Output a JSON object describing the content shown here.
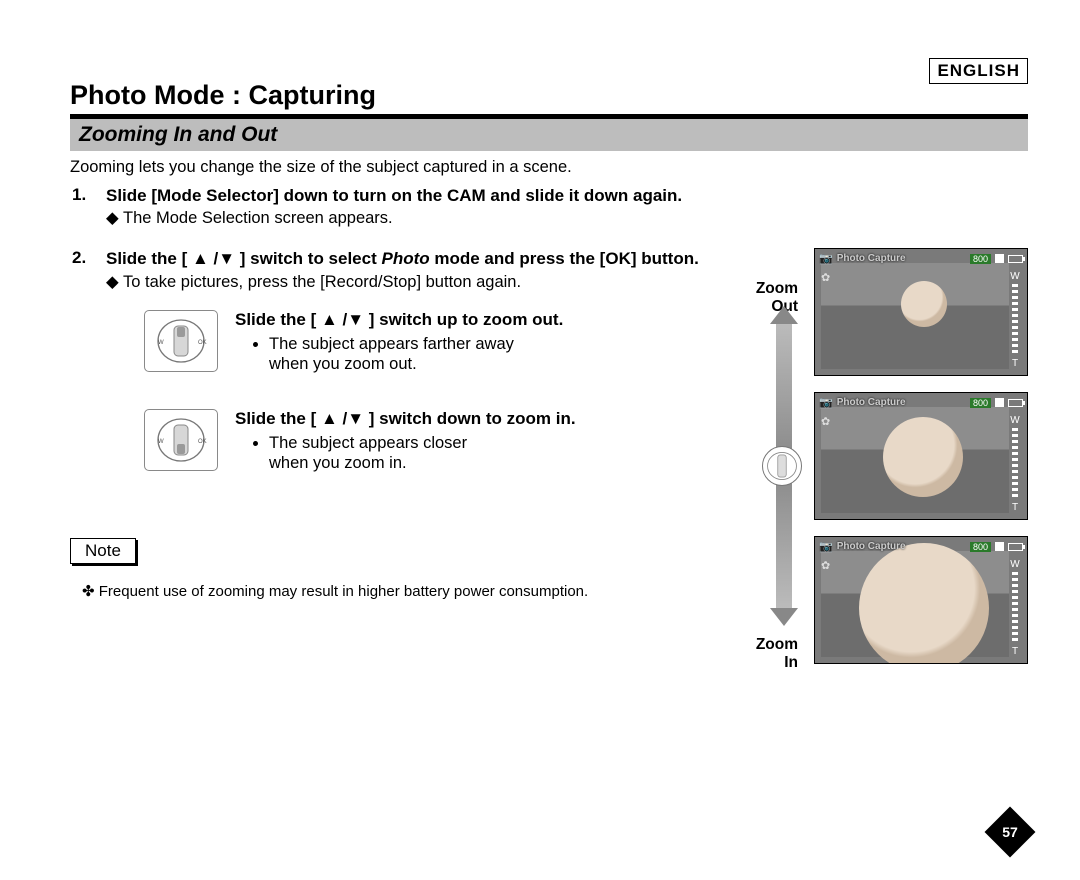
{
  "language": "ENGLISH",
  "title": "Photo Mode : Capturing",
  "section": "Zooming In and Out",
  "intro": "Zooming lets you change the size of the subject captured in a scene.",
  "steps": [
    {
      "main": "Slide [Mode Selector] down to turn on the CAM and slide it down again.",
      "sub": "The Mode Selection screen appears."
    },
    {
      "main_pre": "Slide the [ ▲ /▼ ] switch to select ",
      "main_em": "Photo",
      "main_post": " mode and press the [OK] button.",
      "sub": "To take pictures, press the [Record/Stop] button again."
    }
  ],
  "switch_blocks": [
    {
      "title": "Slide the [ ▲ /▼ ] switch up to zoom out.",
      "bullet1": "The subject appears farther away",
      "bullet2": "when you zoom out."
    },
    {
      "title": "Slide the [ ▲ /▼ ] switch down to zoom in.",
      "bullet1": "The subject appears closer",
      "bullet2": "when you zoom in."
    }
  ],
  "zoom": {
    "out": "Zoom Out",
    "in": "Zoom In"
  },
  "preview": {
    "mode_label": "Photo Capture",
    "size": "800",
    "w": "W",
    "t": "T"
  },
  "note": {
    "label": "Note",
    "text": "Frequent use of zooming may result in higher battery power consumption."
  },
  "page_number": "57"
}
